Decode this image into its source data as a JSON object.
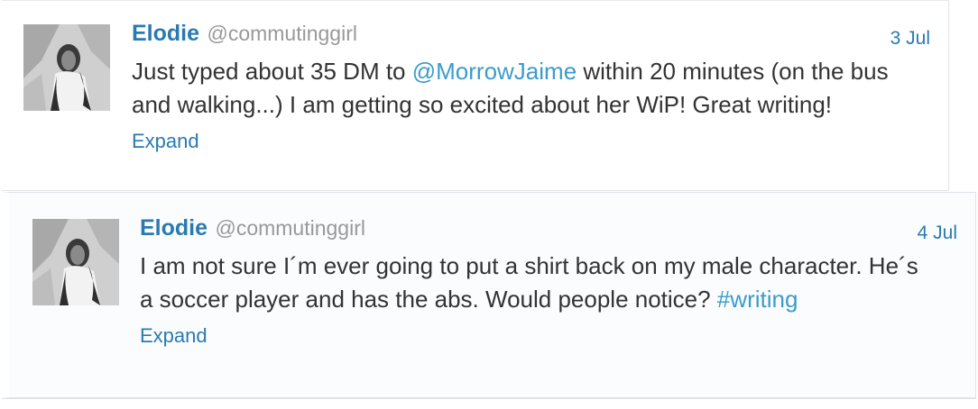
{
  "tweets": [
    {
      "name": "Elodie",
      "handle": "@commutinggirl",
      "date": "3 Jul",
      "text_before": "Just typed about 35 DM to ",
      "mention": "@MorrowJaime",
      "text_after": " within 20 minutes (on the bus and walking...) I am getting so excited about her WiP! Great writing!",
      "expand_label": "Expand"
    },
    {
      "name": "Elodie",
      "handle": "@commutinggirl",
      "date": "4 Jul",
      "text_before": "I am not sure I´m ever going to put a shirt back on my male character. He´s a soccer player and has the abs. Would people notice? ",
      "hashtag": "#writing",
      "expand_label": "Expand"
    }
  ],
  "colors": {
    "name": "#2a7ab0",
    "link": "#3b9ccc",
    "handle": "#999999",
    "text": "#333333"
  }
}
